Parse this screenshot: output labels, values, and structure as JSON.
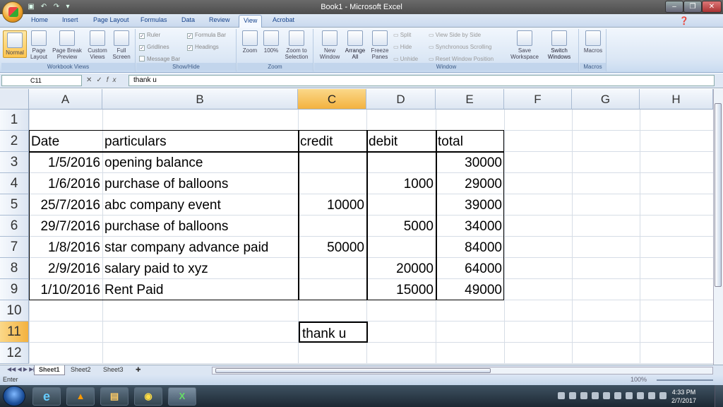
{
  "window": {
    "title": "Book1 - Microsoft Excel",
    "minimize": "–",
    "restore": "❐",
    "close": "✕"
  },
  "ribbon": {
    "tabs": [
      "Home",
      "Insert",
      "Page Layout",
      "Formulas",
      "Data",
      "Review",
      "View",
      "Acrobat"
    ],
    "active_tab": "View",
    "groups": {
      "workbook_views": {
        "label": "Workbook Views",
        "buttons": [
          "Normal",
          "Page Layout",
          "Page Break Preview",
          "Custom Views",
          "Full Screen"
        ]
      },
      "show_hide": {
        "label": "Show/Hide",
        "ruler": "Ruler",
        "gridlines": "Gridlines",
        "message_bar": "Message Bar",
        "formula_bar": "Formula Bar",
        "headings": "Headings"
      },
      "zoom": {
        "label": "Zoom",
        "buttons": [
          "Zoom",
          "100%",
          "Zoom to Selection"
        ]
      },
      "window": {
        "label": "Window",
        "new_window": "New Window",
        "arrange_all": "Arrange All",
        "freeze_panes": "Freeze Panes",
        "split": "Split",
        "hide": "Hide",
        "unhide": "Unhide",
        "side_by_side": "View Side by Side",
        "sync_scroll": "Synchronous Scrolling",
        "reset_pos": "Reset Window Position",
        "save_workspace": "Save Workspace",
        "switch_windows": "Switch Windows"
      },
      "macros": {
        "label": "Macros",
        "button": "Macros"
      }
    }
  },
  "formula_bar": {
    "name_box": "C11",
    "fx": "fx",
    "content": "thank u"
  },
  "sheet": {
    "columns": [
      "A",
      "B",
      "C",
      "D",
      "E",
      "F",
      "G",
      "H"
    ],
    "selected_column": "C",
    "rows": [
      "1",
      "2",
      "3",
      "4",
      "5",
      "6",
      "7",
      "8",
      "9",
      "10",
      "11",
      "12"
    ],
    "selected_row": "11",
    "header": {
      "date": "Date",
      "particulars": "particulars",
      "credit": "credit",
      "debit": "debit",
      "total": "total"
    },
    "entries": [
      {
        "date": "1/5/2016",
        "particulars": "opening balance",
        "credit": "",
        "debit": "",
        "total": "30000"
      },
      {
        "date": "1/6/2016",
        "particulars": "purchase of balloons",
        "credit": "",
        "debit": "1000",
        "total": "29000"
      },
      {
        "date": "25/7/2016",
        "particulars": "abc company event",
        "credit": "10000",
        "debit": "",
        "total": "39000"
      },
      {
        "date": "29/7/2016",
        "particulars": "purchase of balloons",
        "credit": "",
        "debit": "5000",
        "total": "34000"
      },
      {
        "date": "1/8/2016",
        "particulars": "star company advance paid",
        "credit": "50000",
        "debit": "",
        "total": "84000"
      },
      {
        "date": "2/9/2016",
        "particulars": "salary paid to xyz",
        "credit": "",
        "debit": "20000",
        "total": "64000"
      },
      {
        "date": "1/10/2016",
        "particulars": "Rent Paid",
        "credit": "",
        "debit": "15000",
        "total": "49000"
      }
    ],
    "active_cell_text": "thank u"
  },
  "sheet_tabs": [
    "Sheet1",
    "Sheet2",
    "Sheet3"
  ],
  "status": {
    "mode": "Enter",
    "zoom": "100%"
  },
  "taskbar": {
    "time": "4:33 PM",
    "date": "2/7/2017"
  }
}
